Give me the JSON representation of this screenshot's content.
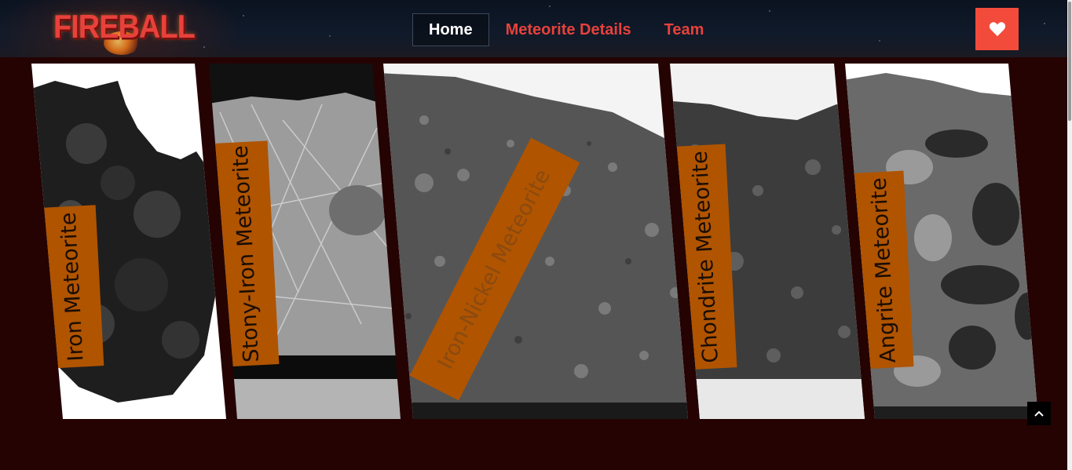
{
  "brand": {
    "logo_text": "FIREBALL"
  },
  "nav": {
    "items": [
      {
        "label": "Home",
        "active": true
      },
      {
        "label": "Meteorite Details",
        "active": false
      },
      {
        "label": "Team",
        "active": false
      }
    ]
  },
  "header_actions": {
    "favorite_icon": "heart-icon"
  },
  "gallery": {
    "slices": [
      {
        "label": "Iron Meteorite"
      },
      {
        "label": "Stony-Iron Meteorite"
      },
      {
        "label": "Iron-Nickel Meteorite"
      },
      {
        "label": "Chondrite Meteorite"
      },
      {
        "label": "Angrite Meteorite"
      }
    ]
  },
  "scroll_top": {
    "icon": "chevron-up-icon"
  },
  "colors": {
    "accent": "#f24b3b",
    "nav_text": "#e8413b",
    "page_background": "#250303",
    "tag_background": "#b05400"
  }
}
